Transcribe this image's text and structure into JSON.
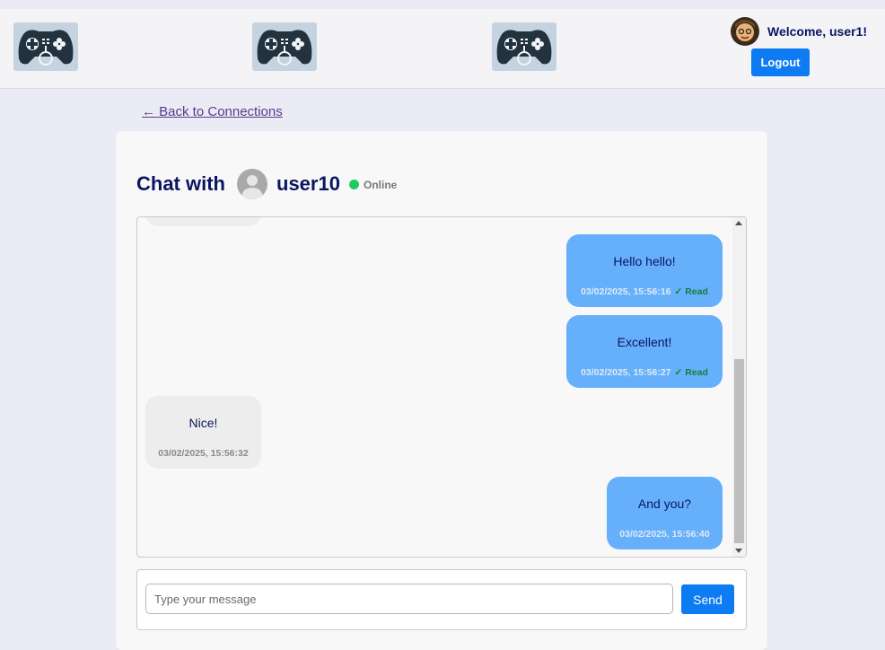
{
  "header": {
    "logos": [
      {
        "icon": "gamepad-logo-icon"
      },
      {
        "icon": "gamepad-logo-icon"
      },
      {
        "icon": "gamepad-logo-icon"
      }
    ],
    "welcome": "Welcome, user1!",
    "logout_label": "Logout"
  },
  "nav": {
    "back_label": "← Back to Connections"
  },
  "chat": {
    "title": "Chat with",
    "peer_name": "user10",
    "status": "Online",
    "status_color": "#1ecb63"
  },
  "messages": [
    {
      "direction": "sent",
      "text": "Hello hello!",
      "time": "03/02/2025, 15:56:16",
      "read": "✓ Read"
    },
    {
      "direction": "sent",
      "text": "Excellent!",
      "time": "03/02/2025, 15:56:27",
      "read": "✓ Read"
    },
    {
      "direction": "received",
      "text": "Nice!",
      "time": "03/02/2025, 15:56:32"
    },
    {
      "direction": "sent",
      "text": "And you?",
      "time": "03/02/2025, 15:56:40"
    }
  ],
  "composer": {
    "placeholder": "Type your message",
    "value": "",
    "send_label": "Send"
  },
  "colors": {
    "accent": "#0d7cf2",
    "sent_bubble": "#66b0fb",
    "received_bubble": "#ededed",
    "title_text": "#0b1560"
  }
}
